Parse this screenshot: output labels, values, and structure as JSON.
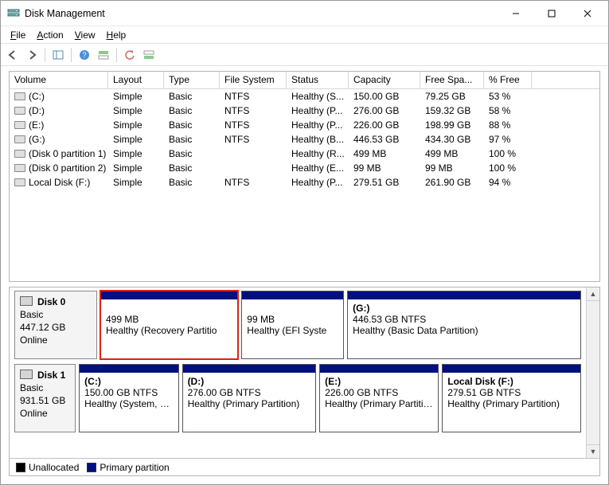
{
  "title": "Disk Management",
  "menubar": [
    "File",
    "Action",
    "View",
    "Help"
  ],
  "columns": {
    "volume": "Volume",
    "layout": "Layout",
    "type": "Type",
    "fs": "File System",
    "status": "Status",
    "cap": "Capacity",
    "free": "Free Spa...",
    "pfree": "% Free"
  },
  "volumes": [
    {
      "name": "(C:)",
      "layout": "Simple",
      "type": "Basic",
      "fs": "NTFS",
      "status": "Healthy (S...",
      "cap": "150.00 GB",
      "free": "79.25 GB",
      "pfree": "53 %"
    },
    {
      "name": "(D:)",
      "layout": "Simple",
      "type": "Basic",
      "fs": "NTFS",
      "status": "Healthy (P...",
      "cap": "276.00 GB",
      "free": "159.32 GB",
      "pfree": "58 %"
    },
    {
      "name": "(E:)",
      "layout": "Simple",
      "type": "Basic",
      "fs": "NTFS",
      "status": "Healthy (P...",
      "cap": "226.00 GB",
      "free": "198.99 GB",
      "pfree": "88 %"
    },
    {
      "name": "(G:)",
      "layout": "Simple",
      "type": "Basic",
      "fs": "NTFS",
      "status": "Healthy (B...",
      "cap": "446.53 GB",
      "free": "434.30 GB",
      "pfree": "97 %"
    },
    {
      "name": "(Disk 0 partition 1)",
      "layout": "Simple",
      "type": "Basic",
      "fs": "",
      "status": "Healthy (R...",
      "cap": "499 MB",
      "free": "499 MB",
      "pfree": "100 %"
    },
    {
      "name": "(Disk 0 partition 2)",
      "layout": "Simple",
      "type": "Basic",
      "fs": "",
      "status": "Healthy (E...",
      "cap": "99 MB",
      "free": "99 MB",
      "pfree": "100 %"
    },
    {
      "name": "Local Disk (F:)",
      "layout": "Simple",
      "type": "Basic",
      "fs": "NTFS",
      "status": "Healthy (P...",
      "cap": "279.51 GB",
      "free": "261.90 GB",
      "pfree": "94 %"
    }
  ],
  "disks": [
    {
      "name": "Disk 0",
      "type": "Basic",
      "size": "447.12 GB",
      "state": "Online",
      "parts": [
        {
          "name": "",
          "line1": "499 MB",
          "line2": "Healthy (Recovery Partitio",
          "flex": "1.35",
          "highlight": true
        },
        {
          "name": "",
          "line1": "99 MB",
          "line2": "Healthy (EFI Syste",
          "flex": "1"
        },
        {
          "name": "(G:)",
          "line1": "446.53 GB NTFS",
          "line2": "Healthy (Basic Data Partition)",
          "flex": "2.3"
        }
      ]
    },
    {
      "name": "Disk 1",
      "type": "Basic",
      "size": "931.51 GB",
      "state": "Online",
      "parts": [
        {
          "name": "(C:)",
          "line1": "150.00 GB NTFS",
          "line2": "Healthy (System, Boot, Pa",
          "flex": "1"
        },
        {
          "name": "(D:)",
          "line1": "276.00 GB NTFS",
          "line2": "Healthy (Primary Partition)",
          "flex": "1.35"
        },
        {
          "name": "(E:)",
          "line1": "226.00 GB NTFS",
          "line2": "Healthy (Primary Partition)",
          "flex": "1.2"
        },
        {
          "name": "Local Disk  (F:)",
          "line1": "279.51 GB NTFS",
          "line2": "Healthy (Primary Partition)",
          "flex": "1.4"
        }
      ]
    }
  ],
  "legend": {
    "unallocated": "Unallocated",
    "primary": "Primary partition"
  }
}
